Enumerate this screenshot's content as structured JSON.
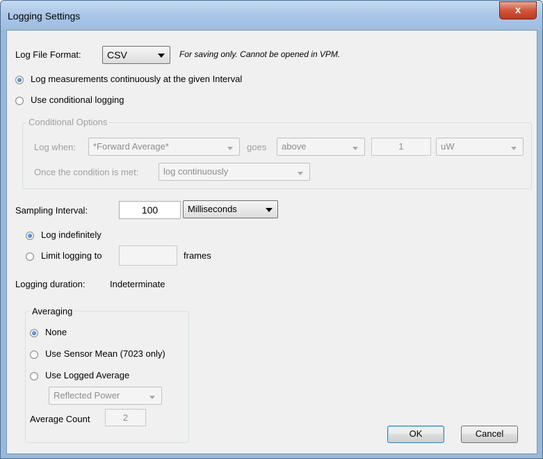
{
  "window": {
    "title": "Logging Settings",
    "close_label": "x"
  },
  "log_format": {
    "label": "Log File Format:",
    "value": "CSV",
    "note": "For saving only. Cannot be opened in VPM."
  },
  "mode": {
    "continuous_label": "Log measurements continuously at the given Interval",
    "conditional_label": "Use conditional logging",
    "selected": "continuous"
  },
  "conditional": {
    "group_title": "Conditional Options",
    "log_when_label": "Log when:",
    "log_when_value": "*Forward Average*",
    "goes_label": "goes",
    "direction_value": "above",
    "threshold_value": "1",
    "unit_value": "uW",
    "once_label": "Once the condition is met:",
    "once_value": "log continuously"
  },
  "sampling": {
    "label": "Sampling Interval:",
    "value": "100",
    "unit": "Milliseconds"
  },
  "limit": {
    "indefinite_label": "Log indefinitely",
    "limit_label": "Limit logging to",
    "frames_value": "",
    "frames_label": "frames",
    "selected": "indefinite"
  },
  "duration": {
    "label": "Logging duration:",
    "value": "Indeterminate"
  },
  "averaging": {
    "group_title": "Averaging",
    "none_label": "None",
    "sensor_mean_label": "Use Sensor Mean (7023 only)",
    "logged_avg_label": "Use Logged Average",
    "logged_avg_source": "Reflected Power",
    "count_label": "Average Count",
    "count_value": "2",
    "selected": "none"
  },
  "buttons": {
    "ok": "OK",
    "cancel": "Cancel"
  }
}
